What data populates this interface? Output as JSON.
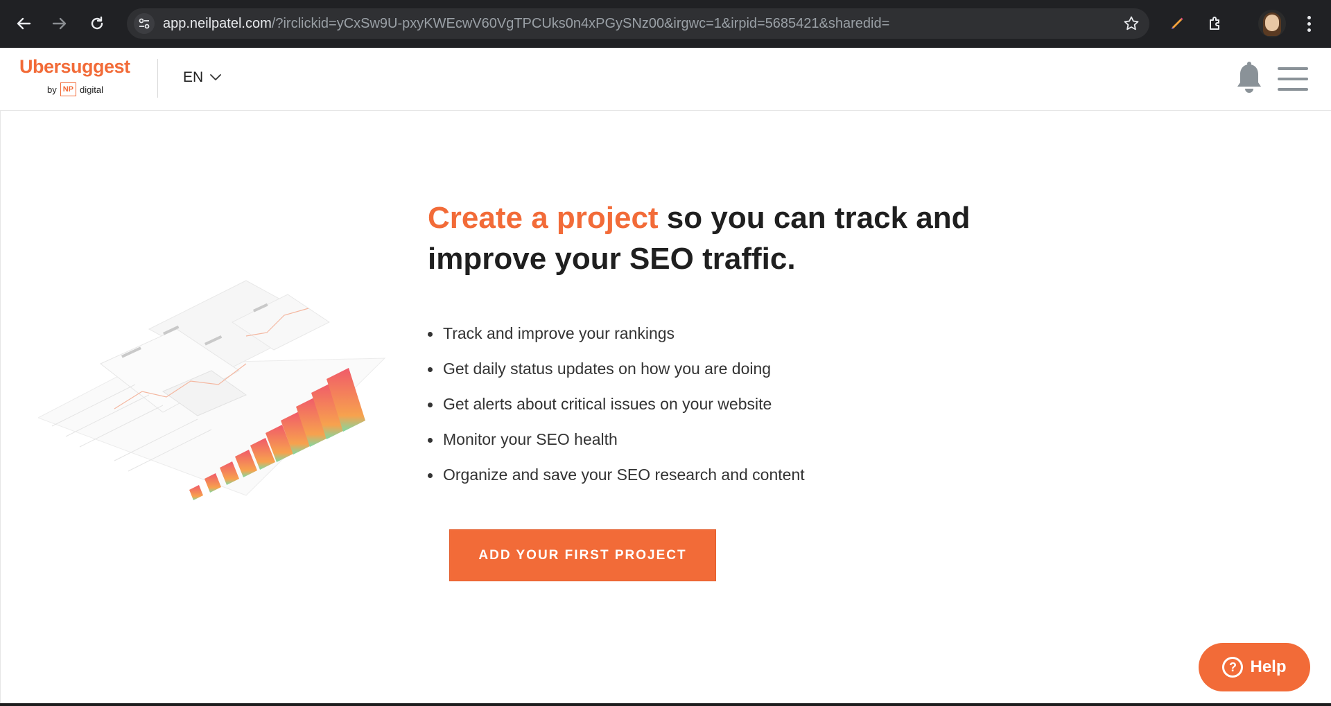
{
  "browser": {
    "url_host": "app.neilpatel.com",
    "url_path": "/?irclickid=yCxSw9U-pxyKWEcwV60VgTPCUks0n4xPGySNz00&irgwc=1&irpid=5685421&sharedid=",
    "icons": [
      "back-arrow-icon",
      "forward-arrow-icon",
      "reload-icon",
      "site-settings-icon",
      "bookmark-star-icon",
      "extension-pen-icon",
      "extensions-puzzle-icon",
      "profile-avatar",
      "more-vert-icon"
    ]
  },
  "header": {
    "logo_word": "Ubersuggest",
    "logo_by": "by",
    "logo_np": "NP",
    "logo_digital": "digital",
    "language": "EN"
  },
  "main": {
    "headline_accent": "Create a project",
    "headline_rest": " so you can track and improve your SEO traffic.",
    "bullets": [
      "Track and improve your rankings",
      "Get daily status updates on how you are doing",
      "Get alerts about critical issues on your website",
      "Monitor your SEO health",
      "Organize and save your SEO research and content"
    ],
    "cta_label": "ADD YOUR FIRST PROJECT"
  },
  "help": {
    "label": "Help",
    "icon_glyph": "?"
  },
  "colors": {
    "brand": "#f26b38",
    "chrome_bg": "#202124",
    "text_dark": "#1f1f1f"
  }
}
